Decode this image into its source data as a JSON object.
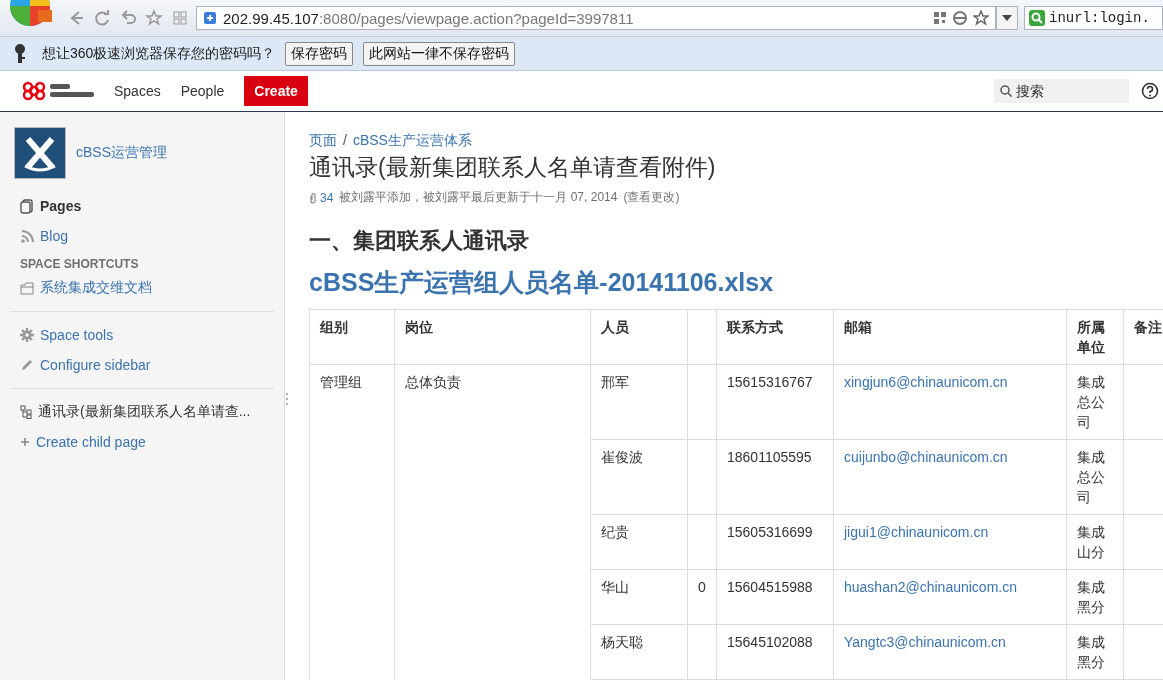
{
  "browser": {
    "url_host": "202.99.45.107",
    "url_rest": ":8080/pages/viewpage.action?pageId=3997811",
    "search_value": "inurl:login."
  },
  "password_bar": {
    "message": "想让360极速浏览器保存您的密码吗？",
    "buttons": [
      "保存密码",
      "此网站一律不保存密码"
    ]
  },
  "header": {
    "nav": [
      "Spaces",
      "People"
    ],
    "create": "Create",
    "search_placeholder": "搜索"
  },
  "sidebar": {
    "space_name": "cBSS运营管理",
    "nav": [
      {
        "label": "Pages",
        "kind": "pages",
        "selected": true
      },
      {
        "label": "Blog",
        "kind": "blog",
        "selected": false
      }
    ],
    "shortcuts_heading": "SPACE SHORTCUTS",
    "shortcuts": [
      "系统集成交维文档"
    ],
    "tools": [
      {
        "label": "Space tools",
        "kind": "gear"
      },
      {
        "label": "Configure sidebar",
        "kind": "pencil"
      }
    ],
    "page_tree": [
      "通讯录(最新集团联系人名单请查..."
    ],
    "create_child": "Create child page"
  },
  "content": {
    "breadcrumbs": [
      "页面",
      "cBSS生产运营体系"
    ],
    "breadcrumb_separator": "/",
    "title": "通讯录(最新集团联系人名单请查看附件)",
    "attachments": "34",
    "byline": "被刘露平添加，被刘露平最后更新于十一月 07, 2014",
    "changes_link": "(查看更改)",
    "heading": "一、集团联系人通讯录",
    "attachment_link": "cBSS生产运营组人员名单-20141106.xlsx",
    "table": {
      "columns": [
        "组别",
        "岗位",
        "人员",
        "",
        "联系方式",
        "邮箱",
        "所属单位",
        "备注"
      ],
      "group": "管理组",
      "position": "总体负责",
      "rows": [
        {
          "name": "邢军",
          "phone": "15615316767",
          "email": "xingjun6@chinaunicom.cn",
          "unit": "集成总公司"
        },
        {
          "name": "崔俊波",
          "phone": "18601105595",
          "email": "cuijunbo@chinaunicom.cn",
          "unit": "集成总公司"
        },
        {
          "name": "纪贵",
          "phone": "15605316699",
          "email": "jigui1@chinaunicom.cn",
          "unit": "集成山分"
        },
        {
          "name": "华山",
          "column_4": "0",
          "phone": "15604515988",
          "email": "huashan2@chinaunicom.cn",
          "unit": "集成黑分"
        },
        {
          "name": "杨天聪",
          "phone": "15645102088",
          "email": "Yangtc3@chinaunicom.cn",
          "unit": "集成黑分"
        }
      ]
    }
  }
}
